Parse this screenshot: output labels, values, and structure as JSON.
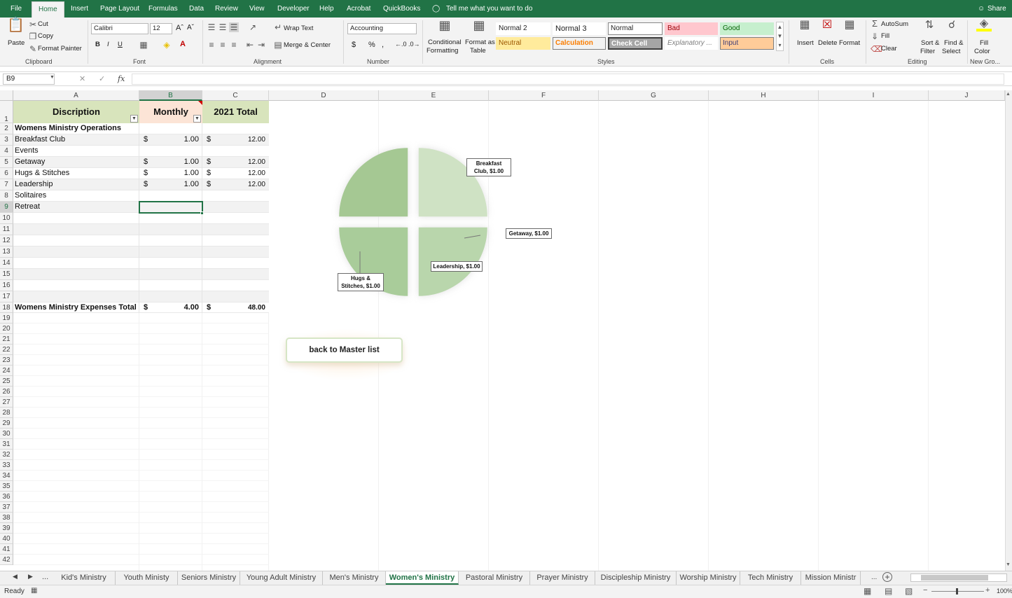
{
  "menu": {
    "items": [
      "File",
      "Home",
      "Insert",
      "Page Layout",
      "Formulas",
      "Data",
      "Review",
      "View",
      "Developer",
      "Help",
      "Acrobat",
      "QuickBooks"
    ],
    "tell_me": "Tell me what you want to do",
    "share": "Share"
  },
  "ribbon": {
    "clipboard": {
      "label": "Clipboard",
      "paste": "Paste",
      "cut": "Cut",
      "copy": "Copy",
      "format_painter": "Format Painter"
    },
    "font": {
      "label": "Font",
      "name": "Calibri",
      "size": "12"
    },
    "alignment": {
      "label": "Alignment",
      "wrap": "Wrap Text",
      "merge": "Merge & Center"
    },
    "number": {
      "label": "Number",
      "format": "Accounting",
      "currency": "$",
      "percent": "%",
      "comma": ","
    },
    "cond_format": {
      "line1": "Conditional",
      "line2": "Formatting"
    },
    "format_table": {
      "line1": "Format as",
      "line2": "Table"
    },
    "styles": {
      "label": "Styles",
      "normal2": "Normal 2",
      "normal3": "Normal 3",
      "normal": "Normal",
      "bad": "Bad",
      "good": "Good",
      "neutral": "Neutral",
      "calculation": "Calculation",
      "check_cell": "Check Cell",
      "explanatory": "Explanatory ...",
      "input": "Input"
    },
    "cells": {
      "label": "Cells",
      "insert": "Insert",
      "delete": "Delete",
      "format": "Format"
    },
    "editing": {
      "label": "Editing",
      "autosum": "AutoSum",
      "fill": "Fill",
      "clear": "Clear",
      "sort1": "Sort &",
      "sort2": "Filter",
      "find1": "Find &",
      "find2": "Select"
    },
    "newgroup": {
      "label": "New Gro...",
      "fill1": "Fill",
      "fill2": "Color"
    },
    "colors": {
      "green": "#217346",
      "bad_bg": "#ffc7ce",
      "good_bg": "#c6efce",
      "neutral_bg": "#ffeb9c",
      "input_bg": "#ffcc99",
      "check_bg": "#a5a5a5"
    }
  },
  "formula_bar": {
    "name_box": "B9",
    "fx": "fx",
    "cancel": "✕",
    "enter": "✓"
  },
  "columns": [
    "A",
    "B",
    "C",
    "D",
    "E",
    "F",
    "G",
    "H",
    "I",
    "J"
  ],
  "selected_column": "B",
  "selected_row": "9",
  "table": {
    "header": {
      "a": "Discription",
      "b": "Monthly",
      "c": "2021 Total"
    },
    "rows": [
      {
        "row": "2",
        "a": "Womens Ministry Operations",
        "b_cur": "",
        "b": "",
        "c_cur": "",
        "c": ""
      },
      {
        "row": "3",
        "a": "Breakfast Club",
        "b_cur": "$",
        "b": "1.00",
        "c_cur": "$",
        "c": "12.00"
      },
      {
        "row": "4",
        "a": "Events",
        "b_cur": "",
        "b": "",
        "c_cur": "",
        "c": ""
      },
      {
        "row": "5",
        "a": "Getaway",
        "b_cur": "$",
        "b": "1.00",
        "c_cur": "$",
        "c": "12.00"
      },
      {
        "row": "6",
        "a": "Hugs & Stitches",
        "b_cur": "$",
        "b": "1.00",
        "c_cur": "$",
        "c": "12.00"
      },
      {
        "row": "7",
        "a": "Leadership",
        "b_cur": "$",
        "b": "1.00",
        "c_cur": "$",
        "c": "12.00"
      },
      {
        "row": "8",
        "a": "Solitaires",
        "b_cur": "",
        "b": "",
        "c_cur": "",
        "c": ""
      },
      {
        "row": "9",
        "a": "Retreat",
        "b_cur": "",
        "b": "",
        "c_cur": "",
        "c": ""
      }
    ],
    "total": {
      "row": "18",
      "a": "Womens Ministry Expenses Total",
      "b_cur": "$",
      "b": "4.00",
      "c_cur": "$",
      "c": "48.00"
    },
    "colors": {
      "header_a": "#d8e4bc",
      "header_b": "#fce4d6",
      "header_c": "#d8e4bc",
      "band": "#f2f2f2"
    }
  },
  "chart_data": {
    "type": "pie",
    "categories": [
      "Breakfast Club",
      "Getaway",
      "Leadership",
      "Hugs & Stitches"
    ],
    "values": [
      1.0,
      1.0,
      1.0,
      1.0
    ],
    "data_labels": [
      "Breakfast Club, $1.00",
      "Getaway,  $1.00",
      "Leadership,  $1.00",
      "Hugs & Stitches, $1.00"
    ],
    "slice_colors": [
      "#cfe2c4",
      "#b9d6ac",
      "#a9cc9a",
      "#a5c893"
    ],
    "legend": "none"
  },
  "button": {
    "label": "back to Master list"
  },
  "sheet_tabs": [
    "Kid's Ministry",
    "Youth Ministy",
    "Seniors Ministry",
    "Young Adult Ministry",
    "Men's Ministry",
    "Women's Ministry",
    "Pastoral Ministry",
    "Prayer Ministry",
    "Discipleship Ministry",
    "Worship Ministry",
    "Tech Ministry",
    "Mission Ministr"
  ],
  "active_tab": "Women's Ministry",
  "status": {
    "ready": "Ready",
    "zoom": "100%"
  }
}
